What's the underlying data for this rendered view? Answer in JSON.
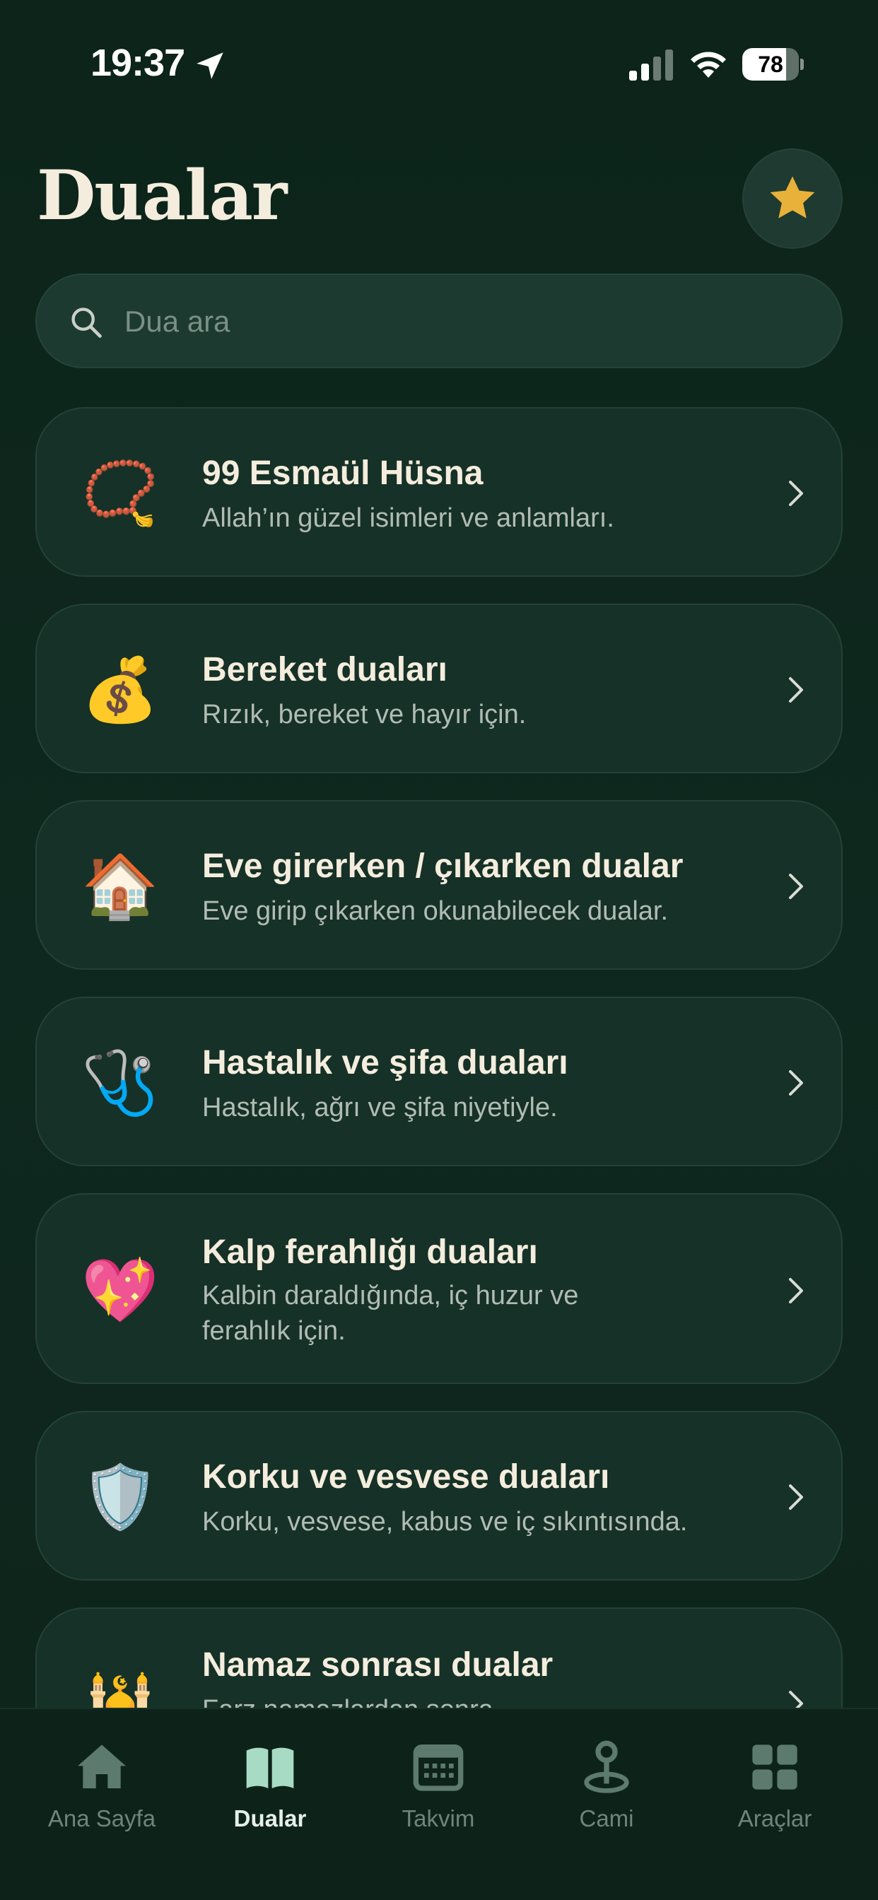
{
  "status": {
    "time": "19:37",
    "battery": "78",
    "battery_level": 0.78
  },
  "header": {
    "title": "Dualar",
    "favorites_icon": "star-icon",
    "accent": "#e8b13a"
  },
  "search": {
    "placeholder": "Dua ara",
    "value": ""
  },
  "categories": [
    {
      "emoji": "📿",
      "icon": "prayer-beads-icon",
      "title": "99 Esmaül Hüsna",
      "subtitle": "Allah’ın güzel isimleri ve anlamları."
    },
    {
      "emoji": "💰",
      "icon": "money-bag-icon",
      "title": "Bereket duaları",
      "subtitle": "Rızık, bereket ve hayır için."
    },
    {
      "emoji": "🏠",
      "icon": "house-icon",
      "title": "Eve girerken / çıkarken dualar",
      "subtitle": "Eve girip çıkarken okunabilecek dualar."
    },
    {
      "emoji": "🩺",
      "icon": "stethoscope-icon",
      "title": "Hastalık ve şifa duaları",
      "subtitle": "Hastalık, ağrı ve şifa niyetiyle."
    },
    {
      "emoji": "💖",
      "icon": "sparkling-heart-icon",
      "title": "Kalp ferahlığı duaları",
      "subtitle": "Kalbin daraldığında, iç huzur ve ferahlık için."
    },
    {
      "emoji": "🛡️",
      "icon": "shield-icon",
      "title": "Korku ve vesvese duaları",
      "subtitle": "Korku, vesvese, kabus ve iç sıkıntısında."
    },
    {
      "emoji": "🕌",
      "icon": "mosque-icon",
      "title": "Namaz sonrası dualar",
      "subtitle": "Farz namazlardan sonra"
    }
  ],
  "tabs": [
    {
      "label": "Ana Sayfa",
      "icon": "home-icon",
      "active": false
    },
    {
      "label": "Dualar",
      "icon": "book-icon",
      "active": true
    },
    {
      "label": "Takvim",
      "icon": "calendar-icon",
      "active": false
    },
    {
      "label": "Cami",
      "icon": "location-pin-icon",
      "active": false
    },
    {
      "label": "Araçlar",
      "icon": "grid-icon",
      "active": false
    }
  ]
}
